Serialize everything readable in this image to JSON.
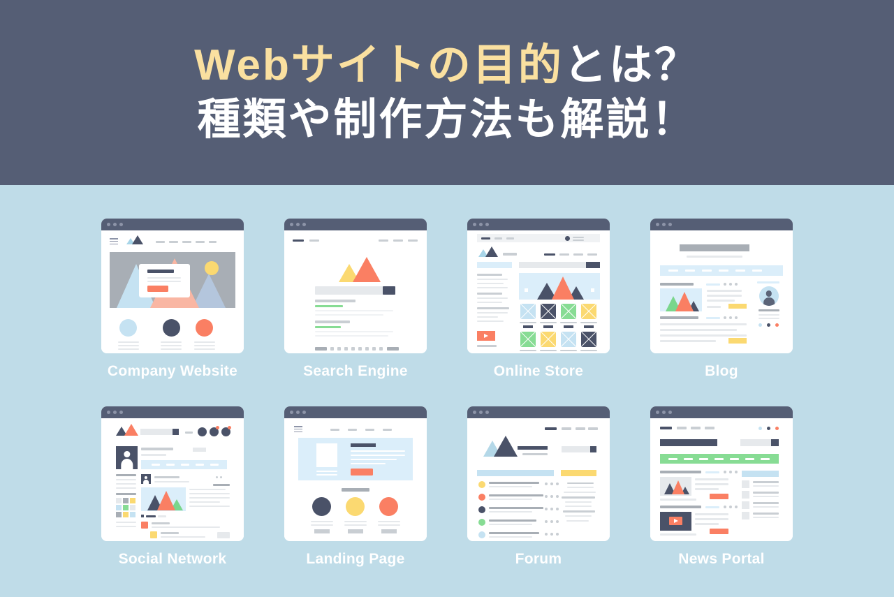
{
  "header": {
    "background_color": "#555e75",
    "accent_color": "#fae0a0",
    "line1_accent": "Webサイトの目的",
    "line1_white": "とは？",
    "line2": "種類や制作方法も解説！"
  },
  "page": {
    "background_color": "#bfdce8",
    "label_color": "#ffffff"
  },
  "cards": [
    {
      "id": "company-website",
      "label": "Company Website"
    },
    {
      "id": "search-engine",
      "label": "Search Engine"
    },
    {
      "id": "online-store",
      "label": "Online Store"
    },
    {
      "id": "blog",
      "label": "Blog"
    },
    {
      "id": "social-network",
      "label": "Social Network"
    },
    {
      "id": "landing-page",
      "label": "Landing Page"
    },
    {
      "id": "forum",
      "label": "Forum"
    },
    {
      "id": "news-portal",
      "label": "News Portal"
    }
  ],
  "palette": {
    "navy": "#4a5268",
    "coral": "#fa7f63",
    "yellow": "#fbd971",
    "green": "#87dc94",
    "light_blue": "#c5e2f2",
    "pale_blue": "#dbeefa",
    "gray": "#a8aeb5",
    "light_gray": "#e6e9ec",
    "title_bar": "#555e75",
    "window_dot": "#8d94a8"
  }
}
